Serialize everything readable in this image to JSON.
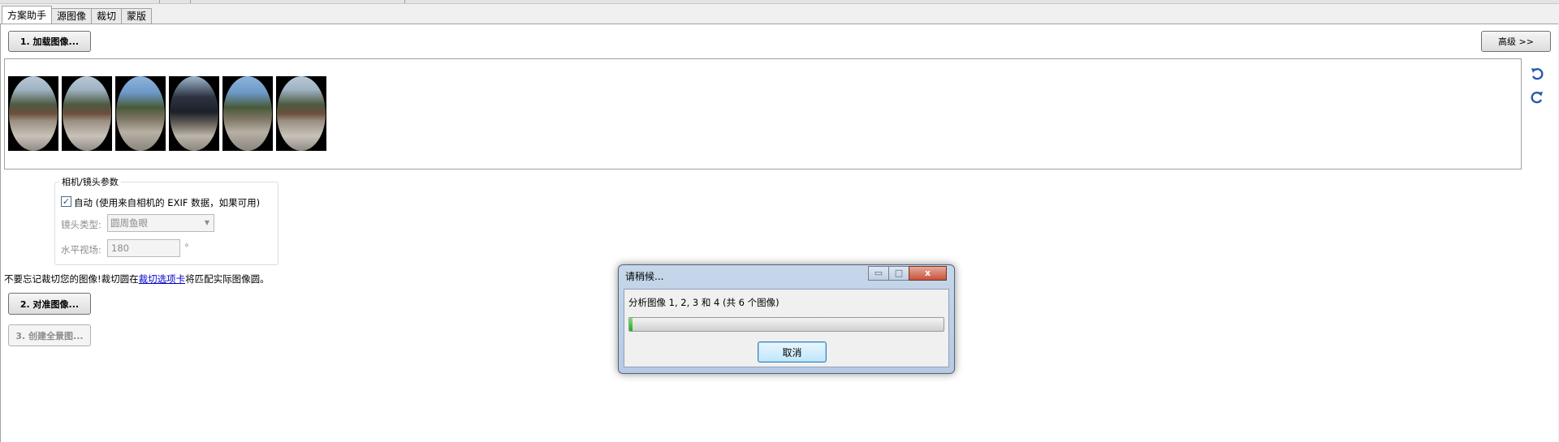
{
  "tabs": [
    {
      "label": "方案助手",
      "active": true
    },
    {
      "label": "源图像",
      "active": false
    },
    {
      "label": "裁切",
      "active": false
    },
    {
      "label": "蒙版",
      "active": false
    }
  ],
  "assistant": {
    "load_button": "1. 加载图像...",
    "advanced_button": "高级 >>",
    "align_button": "2. 对准图像...",
    "create_button": "3. 创建全景图..."
  },
  "thumbnails": [
    {
      "icon": "fisheye-image-icon"
    },
    {
      "icon": "fisheye-image-icon"
    },
    {
      "icon": "fisheye-image-icon"
    },
    {
      "icon": "fisheye-image-icon"
    },
    {
      "icon": "fisheye-image-icon"
    },
    {
      "icon": "fisheye-image-icon"
    }
  ],
  "rotate_icons": [
    "rotate-ccw-icon",
    "rotate-cw-icon"
  ],
  "camera": {
    "group_title": "相机/镜头参数",
    "auto_checked": true,
    "auto_label": "自动 (使用来自相机的 EXIF 数据，如果可用)",
    "lens_type_label": "镜头类型:",
    "lens_type_value": "圆周鱼眼",
    "hfov_label": "水平视场:",
    "hfov_value": "180",
    "hfov_unit": "°"
  },
  "crop_note": {
    "before": "不要忘记裁切您的图像!裁切圆在",
    "link": "裁切选项卡",
    "after": "将匹配实际图像圆。"
  },
  "dialog": {
    "title": "请稍候...",
    "message": "分析图像 1, 2, 3 和 4 (共 6 个图像)",
    "progress_fraction": 0.01,
    "progress_color": "#1fae1f",
    "cancel_button": "取消",
    "minimize_glyph": "▭",
    "maximize_glyph": "□",
    "close_glyph": "x"
  },
  "colors": {
    "link": "#0000cc",
    "accent": "#3c7fb1",
    "rotate_icon": "#2a56b0"
  }
}
